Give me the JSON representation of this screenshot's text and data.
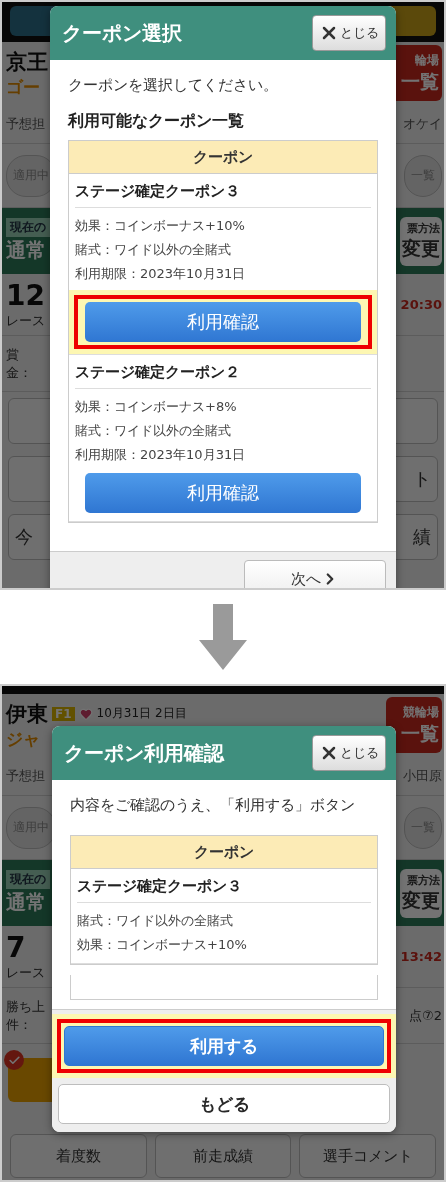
{
  "screens": [
    {
      "background": [
        {
          "kind": "topbar"
        },
        {
          "kind": "venue",
          "name": "京王",
          "sub": "ゴー",
          "right": [
            "輪場",
            "一覧"
          ]
        },
        {
          "kind": "info",
          "left": "予想担",
          "right": "オケイ"
        },
        {
          "kind": "pill",
          "left": "適用中",
          "right": "一覧"
        },
        {
          "kind": "band",
          "label": "現在の",
          "left": "通常",
          "right": [
            "票方法",
            "変更"
          ]
        },
        {
          "kind": "race",
          "number": "12",
          "label": "レース",
          "right": "20:30"
        },
        {
          "kind": "prize",
          "left": [
            "賞",
            "金："
          ]
        },
        {
          "kind": "grey_button"
        },
        {
          "kind": "grey_button",
          "right": "ト"
        },
        {
          "kind": "grey_button",
          "left": "今",
          "right": "績"
        }
      ],
      "modal": {
        "title": "クーポン選択",
        "close": "とじる",
        "intro": "クーポンを選択してください。",
        "heading": "利用可能なクーポン一覧",
        "table_header": "クーポン",
        "coupons": [
          {
            "title": "ステージ確定クーポン３",
            "lines": [
              "効果：コインボーナス+10%",
              "賭式：ワイド以外の全賭式",
              "利用期限：2023年10月31日"
            ],
            "button": "利用確認",
            "highlighted": true
          },
          {
            "title": "ステージ確定クーポン２",
            "lines": [
              "効果：コインボーナス+8%",
              "賭式：ワイド以外の全賭式",
              "利用期限：2023年10月31日"
            ],
            "button": "利用確認",
            "highlighted": false
          }
        ],
        "footer": [
          {
            "label": "次へ",
            "kind": "next"
          }
        ]
      }
    },
    {
      "background": [
        {
          "kind": "strip"
        },
        {
          "kind": "venue",
          "name": "伊東",
          "badge": "F1",
          "heart": true,
          "date": "10月31日 2日目",
          "sub": "ジャ",
          "right": [
            "競輪場",
            "一覧"
          ]
        },
        {
          "kind": "info",
          "left": "予想担",
          "right": "小田原"
        },
        {
          "kind": "pill",
          "left": "適用中",
          "right": "一覧"
        },
        {
          "kind": "band",
          "label": "現在の",
          "left": "通常",
          "right": [
            "票方法",
            "変更"
          ]
        },
        {
          "kind": "race",
          "number": "7",
          "label": "レース",
          "right": "13:42"
        },
        {
          "kind": "prize",
          "left": [
            "勝ち上",
            "件："
          ],
          "right": "点⑦2"
        },
        {
          "kind": "check_button"
        },
        {
          "kind": "button_grid",
          "labels": [
            "着度数",
            "前走成績",
            "選手コメント"
          ]
        }
      ],
      "modal": {
        "title": "クーポン利用確認",
        "close": "とじる",
        "intro": "内容をご確認のうえ、「利用する」ボタン",
        "table_header": "クーポン",
        "coupons": [
          {
            "title": "ステージ確定クーポン３",
            "lines": [
              "賭式：ワイド以外の全賭式",
              "効果：コインボーナス+10%"
            ]
          }
        ],
        "footer": [
          {
            "label": "利用する",
            "kind": "primary",
            "highlighted": true
          },
          {
            "label": "もどる",
            "kind": "secondary",
            "highlighted": false
          }
        ]
      }
    }
  ]
}
